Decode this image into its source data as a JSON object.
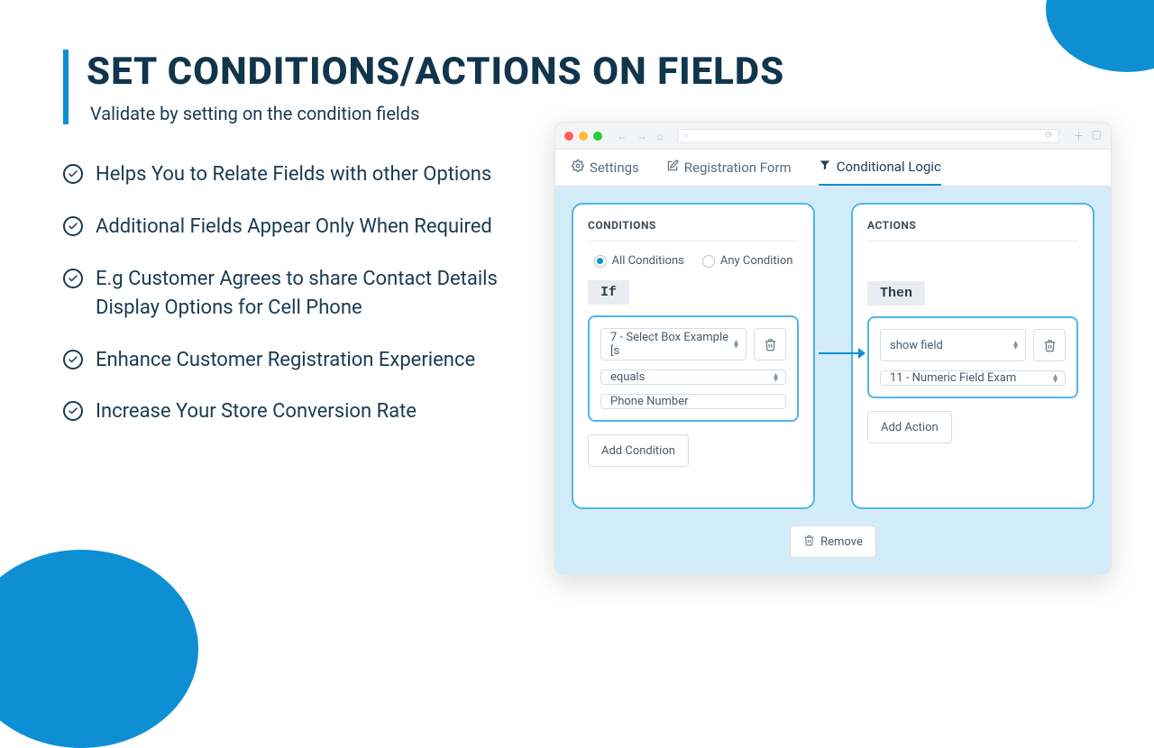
{
  "heading": {
    "title": "SET CONDITIONS/ACTIONS ON FIELDS",
    "subtitle": "Validate by setting on the condition fields"
  },
  "bullets": [
    "Helps You to Relate Fields with other Options",
    "Additional Fields Appear Only When Required",
    "E.g Customer Agrees to share Contact Details Display Options for Cell Phone",
    "Enhance Customer Registration Experience",
    "Increase Your Store Conversion Rate"
  ],
  "colors": {
    "accent": "#0e8fd4"
  },
  "browser": {
    "dots": [
      "#ff5f57",
      "#febc2e",
      "#28c840"
    ],
    "tabs": [
      {
        "label": "Settings",
        "active": false
      },
      {
        "label": "Registration Form",
        "active": false
      },
      {
        "label": "Conditional Logic",
        "active": true
      }
    ]
  },
  "conditions": {
    "heading": "CONDITIONS",
    "mode": {
      "all_label": "All Conditions",
      "any_label": "Any Condition",
      "selected": "all"
    },
    "badge": "If",
    "field_select": "7 - Select Box Example [s",
    "operator": "equals",
    "value": "Phone Number",
    "add_label": "Add Condition"
  },
  "actions": {
    "heading": "ACTIONS",
    "badge": "Then",
    "action_select": "show field",
    "target_select": "11 - Numeric Field Exam",
    "add_label": "Add Action"
  },
  "remove_label": "Remove"
}
